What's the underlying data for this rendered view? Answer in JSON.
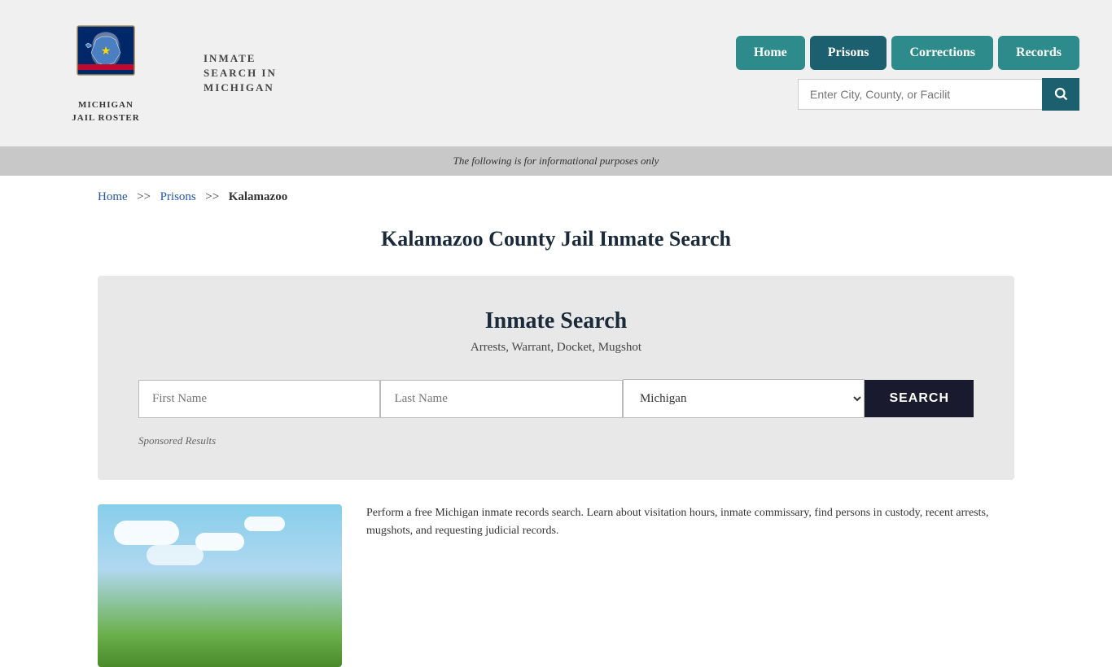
{
  "header": {
    "logo_line1": "MICHIGAN",
    "logo_line2": "JAIL ROSTER",
    "site_title": "INMATE SEARCH IN MICHIGAN",
    "nav": [
      {
        "label": "Home",
        "active": false
      },
      {
        "label": "Prisons",
        "active": true
      },
      {
        "label": "Corrections",
        "active": false
      },
      {
        "label": "Records",
        "active": false
      }
    ],
    "search_placeholder": "Enter City, County, or Facilit"
  },
  "info_bar": {
    "text": "The following is for informational purposes only"
  },
  "breadcrumb": {
    "home": "Home",
    "prisons": "Prisons",
    "current": "Kalamazoo"
  },
  "page_title": "Kalamazoo County Jail Inmate Search",
  "search_box": {
    "title": "Inmate Search",
    "subtitle": "Arrests, Warrant, Docket, Mugshot",
    "first_name_placeholder": "First Name",
    "last_name_placeholder": "Last Name",
    "state_default": "Michigan",
    "search_btn": "SEARCH",
    "sponsored_label": "Sponsored Results"
  },
  "bottom_text": "Perform a free Michigan inmate records search. Learn about visitation hours, inmate commissary, find persons in custody, recent arrests, mugshots, and requesting judicial records."
}
